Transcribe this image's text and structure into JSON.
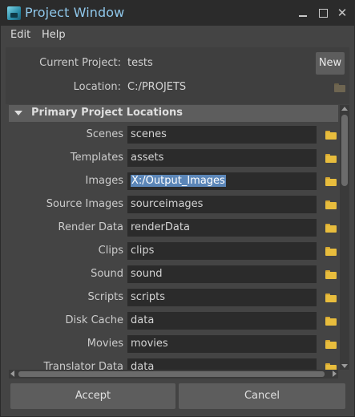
{
  "window": {
    "title": "Project Window"
  },
  "menu": {
    "items": [
      {
        "label": "Edit"
      },
      {
        "label": "Help"
      }
    ]
  },
  "project": {
    "current_label": "Current Project:",
    "current_value": "tests",
    "new_label": "New",
    "location_label": "Location:",
    "location_value": "C:/PROJETS"
  },
  "section": {
    "title": "Primary Project Locations",
    "rows": [
      {
        "label": "Scenes",
        "value": "scenes"
      },
      {
        "label": "Templates",
        "value": "assets"
      },
      {
        "label": "Images",
        "value": "X:/Output_Images",
        "selected": true
      },
      {
        "label": "Source Images",
        "value": "sourceimages"
      },
      {
        "label": "Render Data",
        "value": "renderData"
      },
      {
        "label": "Clips",
        "value": "clips"
      },
      {
        "label": "Sound",
        "value": "sound"
      },
      {
        "label": "Scripts",
        "value": "scripts"
      },
      {
        "label": "Disk Cache",
        "value": "data"
      },
      {
        "label": "Movies",
        "value": "movies"
      },
      {
        "label": "Translator Data",
        "value": "data"
      }
    ]
  },
  "buttons": {
    "accept": "Accept",
    "cancel": "Cancel"
  },
  "colors": {
    "title_text": "#8fc7ea",
    "selection": "#5b86b8",
    "folder": "#e8bd3d"
  }
}
